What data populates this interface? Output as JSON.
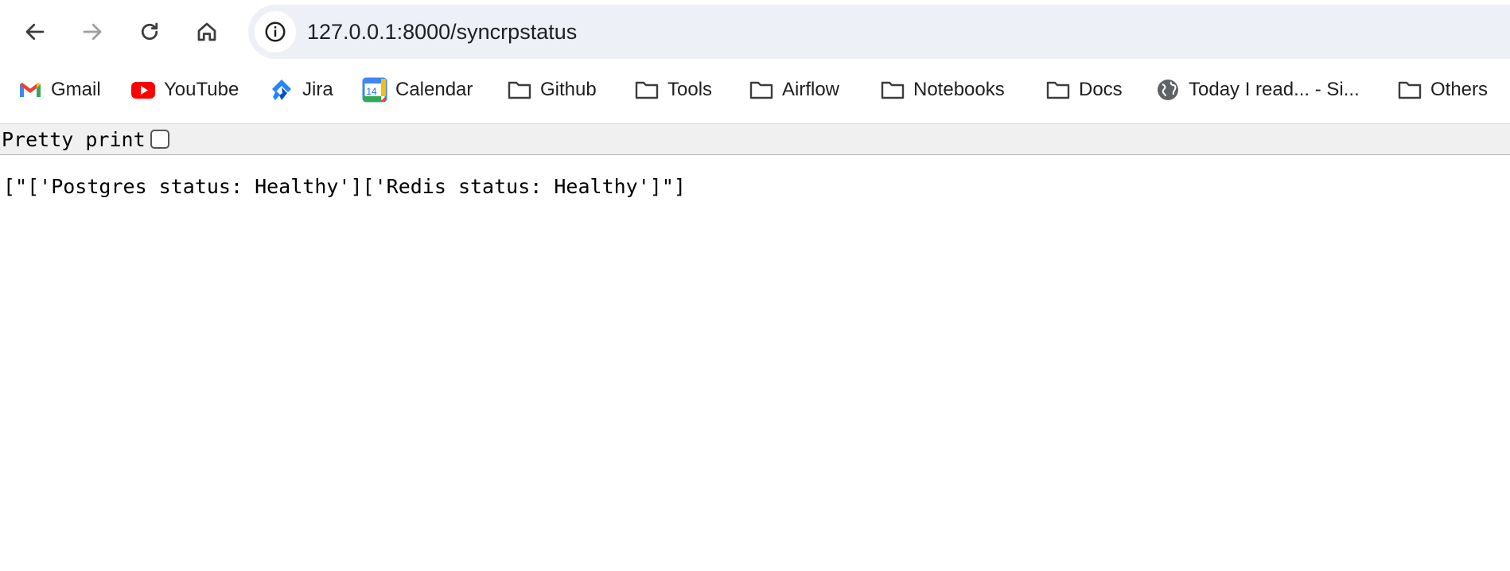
{
  "toolbar": {
    "back_icon": "arrow-left-icon",
    "forward_icon": "arrow-right-icon",
    "reload_icon": "reload-icon",
    "home_icon": "home-icon",
    "url": "127.0.0.1:8000/syncrpstatus"
  },
  "bookmarks": [
    {
      "label": "Gmail",
      "icon": "gmail-icon"
    },
    {
      "label": "YouTube",
      "icon": "youtube-icon"
    },
    {
      "label": "Jira",
      "icon": "jira-icon"
    },
    {
      "label": "Calendar",
      "icon": "calendar-icon",
      "icon_text": "14"
    },
    {
      "label": "Github",
      "icon": "folder-icon"
    },
    {
      "label": "Tools",
      "icon": "folder-icon"
    },
    {
      "label": "Airflow",
      "icon": "folder-icon"
    },
    {
      "label": "Notebooks",
      "icon": "folder-icon"
    },
    {
      "label": "Docs",
      "icon": "folder-icon"
    },
    {
      "label": "Today I read... - Si...",
      "icon": "globe-icon"
    },
    {
      "label": "Others",
      "icon": "folder-icon"
    }
  ],
  "pretty_print": {
    "label": "Pretty print",
    "checked": false
  },
  "content": {
    "json_text": "[\"['Postgres status: Healthy']['Redis status: Healthy']\"]"
  },
  "colors": {
    "omnibox_bg": "#edf0f7",
    "text": "#1f1f1f",
    "disabled_icon": "#9e9e9e",
    "gmail_red": "#ea4335",
    "youtube_red": "#ff0000",
    "jira_blue": "#2684ff"
  }
}
